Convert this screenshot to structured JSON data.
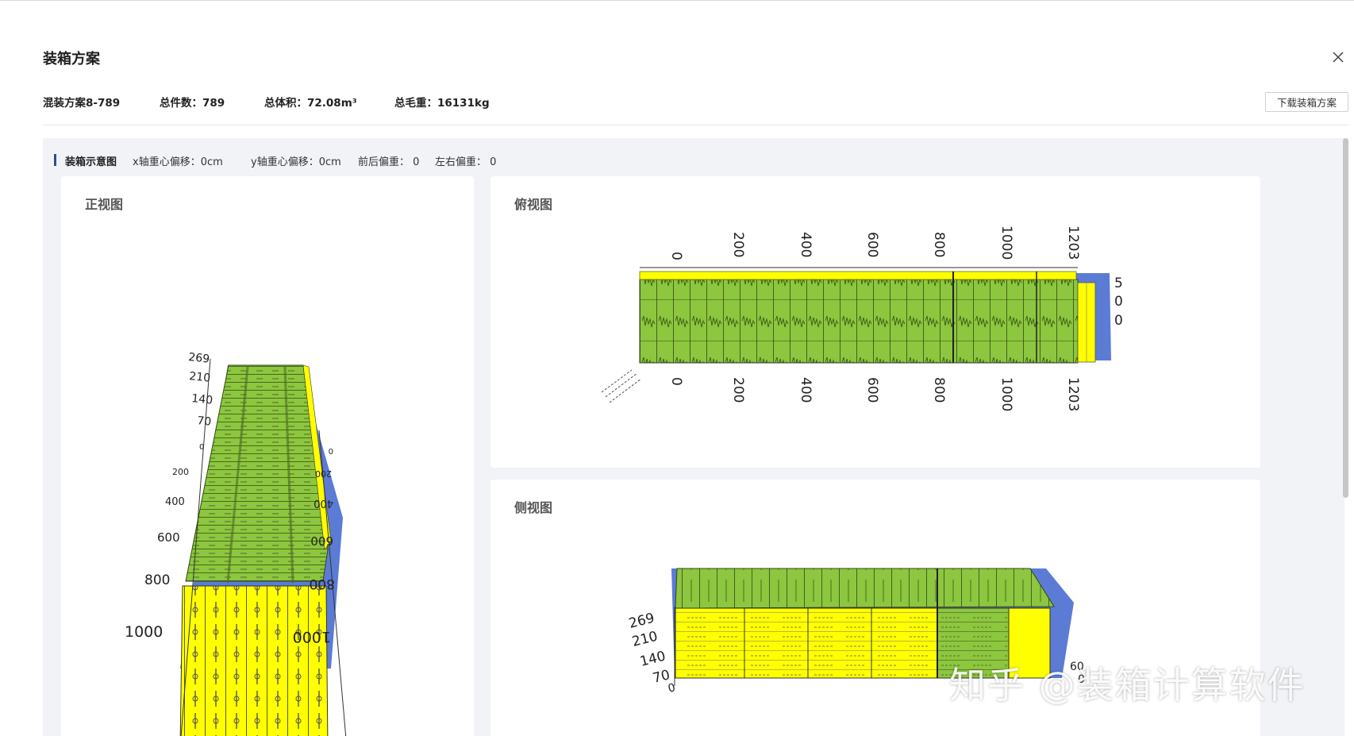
{
  "modal": {
    "title": "装箱方案"
  },
  "summary": {
    "plan_name": "混装方案8-789",
    "total_pieces": "总件数：789",
    "total_volume": "总体积：72.08m³",
    "gross_weight": "总毛重：16131kg"
  },
  "download_label": "下载装箱方案",
  "section": {
    "title": "装箱示意图",
    "x_offset": "x轴重心偏移：0cm",
    "y_offset": "y轴重心偏移：0cm",
    "front_back_bias": "前后偏重：  0",
    "left_right_bias": "左右偏重：  0"
  },
  "views": {
    "front": {
      "title": "正视图",
      "left_ticks": [
        "269",
        "210",
        "140",
        "70",
        "0",
        "200",
        "400",
        "600",
        "800",
        "1000"
      ],
      "right_ticks": [
        "0",
        "200",
        "400",
        "600",
        "800",
        "1000"
      ]
    },
    "top": {
      "title": "俯视图",
      "top_ticks": [
        "0",
        "200",
        "400",
        "600",
        "800",
        "1000",
        "1203"
      ],
      "bottom_ticks": [
        "0",
        "200",
        "400",
        "600",
        "800",
        "1000",
        "1203"
      ],
      "side_ticks": [
        "5",
        "0",
        "0"
      ]
    },
    "side": {
      "title": "侧视图",
      "left_ticks": [
        "269",
        "210",
        "140",
        "70",
        "0"
      ],
      "right_ticks": [
        "60",
        "0"
      ]
    }
  },
  "colors": {
    "green": "#8dc63f",
    "yellow": "#ffff00",
    "blue": "#5b7bd5",
    "accent_bar": "#2b4f8a"
  },
  "watermark": "知乎 @装箱计算软件"
}
